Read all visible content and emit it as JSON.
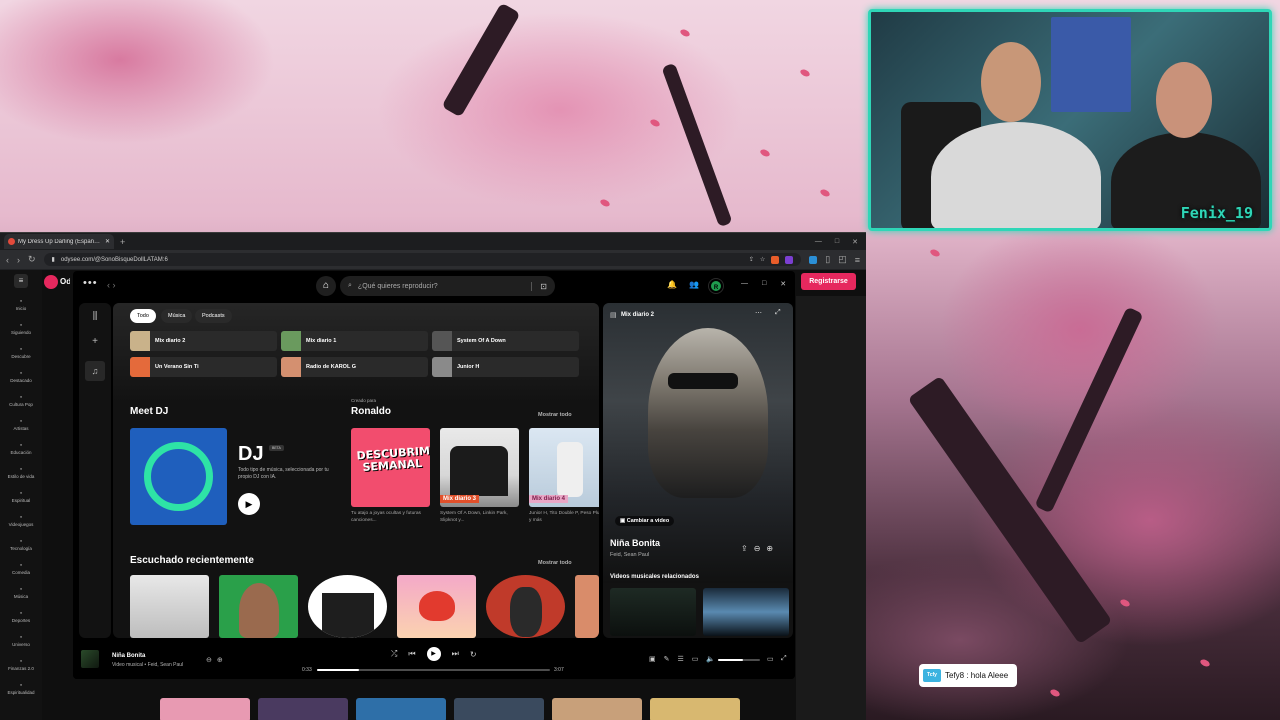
{
  "browser": {
    "tab_title": "My Dress Up Darling (Español La",
    "new_tab_symbol": "+",
    "url": "odysee.com/@SonoBisqueDollLATAM:6",
    "window_controls": [
      "—",
      "□",
      "✕"
    ]
  },
  "odysee": {
    "brand_partial": "Od",
    "sidebar": [
      {
        "icon": "home-icon",
        "label": "Inicio"
      },
      {
        "icon": "heart-icon",
        "label": "Siguiendo"
      },
      {
        "icon": "compass-icon",
        "label": "Descubre"
      },
      {
        "icon": "star-icon",
        "label": "Destacado"
      },
      {
        "icon": "popcorn-icon",
        "label": "Cultura Pop"
      },
      {
        "icon": "brush-icon",
        "label": "Artistas"
      },
      {
        "icon": "education-icon",
        "label": "Educación"
      },
      {
        "icon": "lifestyle-icon",
        "label": "Estilo de vida"
      },
      {
        "icon": "spiritual-icon",
        "label": "Espiritual"
      },
      {
        "icon": "gamepad-icon",
        "label": "Videojuegos"
      },
      {
        "icon": "tech-icon",
        "label": "Tecnología"
      },
      {
        "icon": "comedy-icon",
        "label": "Comedia"
      },
      {
        "icon": "music-icon",
        "label": "Música"
      },
      {
        "icon": "sports-icon",
        "label": "Deportes"
      },
      {
        "icon": "universe-icon",
        "label": "Universo"
      },
      {
        "icon": "finance-icon",
        "label": "Finanzas 2.0"
      },
      {
        "icon": "spirit-icon",
        "label": "Espiritualidad"
      }
    ],
    "register_label": "Registrarse"
  },
  "spotify": {
    "search_placeholder": "¿Qué quieres reproducir?",
    "avatar_initial": "R",
    "filters": [
      "Todo",
      "Música",
      "Podcasts"
    ],
    "shortcuts": [
      {
        "label": "Mix diario 2",
        "color": "#c9b28a"
      },
      {
        "label": "Mix diario 1",
        "color": "#6a9a5e"
      },
      {
        "label": "System Of A Down",
        "color": "#555555"
      },
      {
        "label": "Un Verano Sin Ti",
        "color": "#e46a3b"
      },
      {
        "label": "Radio de KAROL G",
        "color": "#d49070"
      },
      {
        "label": "Junior H",
        "color": "#8a8a8a"
      }
    ],
    "meet_dj": {
      "title": "Meet DJ",
      "big": "DJ",
      "badge": "BETA",
      "desc": "Todo tipo de música, seleccionada por tu propio DJ con IA."
    },
    "made_for": {
      "kicker": "Creado para",
      "name": "Ronaldo",
      "show_all": "Mostrar todo",
      "cards": [
        {
          "title": "DESCUBRIMIENTO SEMANAL",
          "label": "",
          "sub": "Tu atajo a joyas ocultas y futuras canciones..."
        },
        {
          "title": "",
          "label": "Mix diario 3",
          "sub": "System Of A Down, Linkin Park, Slipknot y..."
        },
        {
          "title": "",
          "label": "Mix diario 4",
          "sub": "Junior H, Tito Double P, Peso Pluma y más"
        }
      ]
    },
    "recent": {
      "title": "Escuchado recientemente",
      "show_all": "Mostrar todo"
    },
    "now_playing_panel": {
      "playlist": "Mix diario 2",
      "switch_video": "Cambiar a video",
      "song": "Niña Bonita",
      "artists": "Feid, Sean Paul",
      "related": "Videos musicales relacionados"
    },
    "player": {
      "song": "Niña Bonita",
      "meta": "Video musical • Feid, Sean Paul",
      "time_current": "0:33",
      "time_total": "3:07",
      "progress": 0.18,
      "volume": 0.6
    }
  },
  "webcam": {
    "tag": "Fenix_19"
  },
  "chat": {
    "badge": "Tcfy",
    "message": "Tefy8 : hola Aleee"
  },
  "colors": {
    "spotify_green": "#1f9b4e",
    "odysee_pink": "#e6285e",
    "webcam_border": "#2fd6b7"
  }
}
